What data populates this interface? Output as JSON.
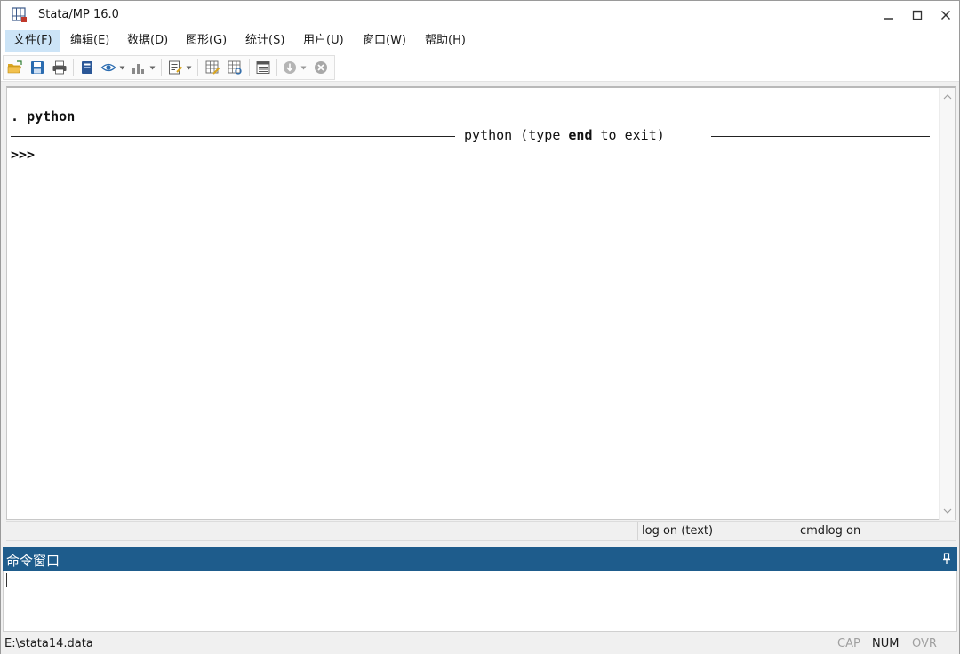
{
  "window": {
    "title": "Stata/MP 16.0"
  },
  "menu": {
    "items": [
      {
        "label": "文件(F)",
        "active": true
      },
      {
        "label": "编辑(E)",
        "active": false
      },
      {
        "label": "数据(D)",
        "active": false
      },
      {
        "label": "图形(G)",
        "active": false
      },
      {
        "label": "统计(S)",
        "active": false
      },
      {
        "label": "用户(U)",
        "active": false
      },
      {
        "label": "窗口(W)",
        "active": false
      },
      {
        "label": "帮助(H)",
        "active": false
      }
    ]
  },
  "toolbar": {
    "icons": [
      "open-folder-icon",
      "save-icon",
      "print-icon",
      "log-icon",
      "viewer-icon",
      "graph-icon",
      "do-file-editor-icon",
      "data-editor-icon",
      "data-browser-icon",
      "variables-manager-icon",
      "more-icon",
      "break-icon"
    ]
  },
  "results": {
    "command_prefix": ". ",
    "command": "python",
    "banner_pre": "python (type ",
    "banner_bold": "end",
    "banner_post": " to exit)",
    "prompt": ">>>"
  },
  "status": {
    "log": "log on (text)",
    "cmdlog": "cmdlog on"
  },
  "command_window": {
    "title": "命令窗口",
    "value": ""
  },
  "statusbar": {
    "path": "E:\\stata14.data",
    "cap": "CAP",
    "num": "NUM",
    "ovr": "OVR"
  },
  "colors": {
    "command_header": "#1e5c8c",
    "active_menu": "#cce4f7",
    "indicator_off": "#a0a0a0",
    "indicator_on": "#1a1a1a"
  }
}
